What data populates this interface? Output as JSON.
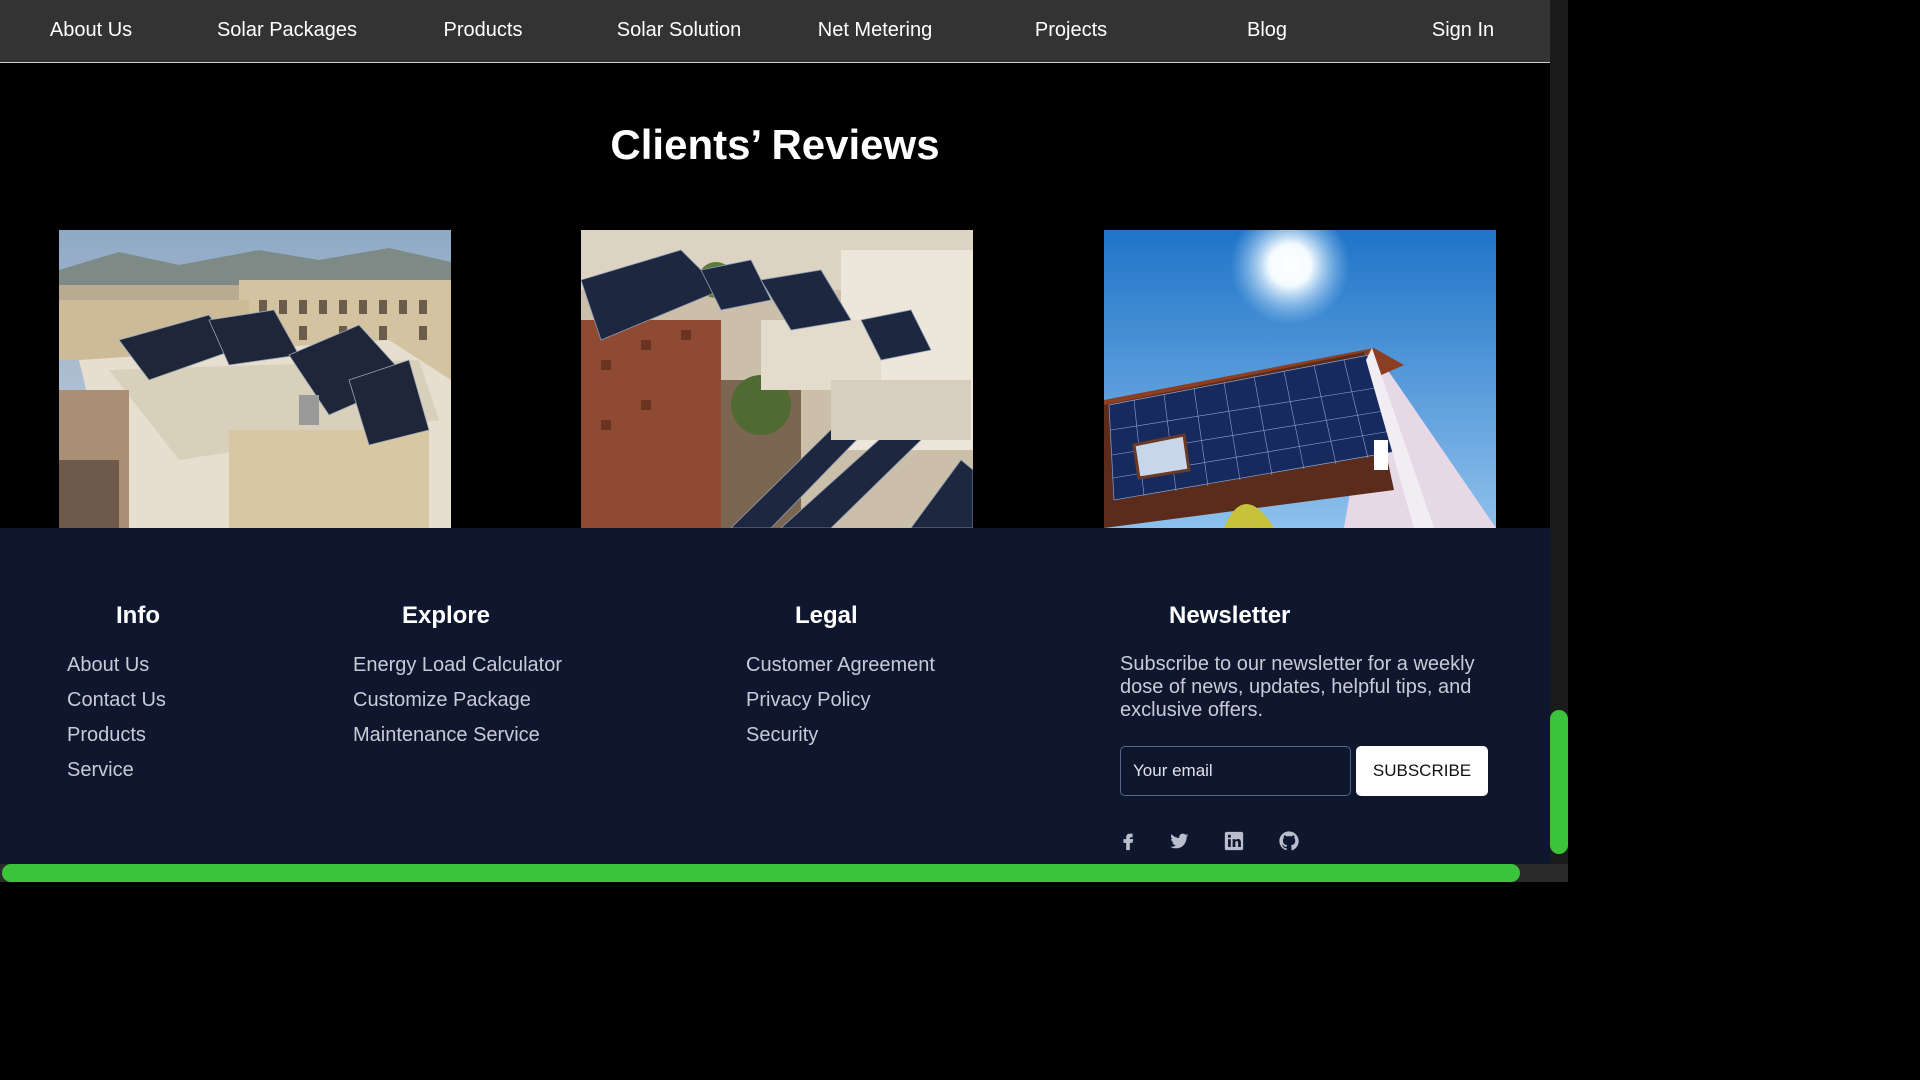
{
  "nav": {
    "items": [
      "About Us",
      "Solar Packages",
      "Products",
      "Solar Solution",
      "Net Metering",
      "Projects",
      "Blog",
      "Sign In"
    ]
  },
  "reviews": {
    "title": "Clients’ Reviews",
    "images": [
      "solar-rooftop-apartment-photo",
      "solar-rooftops-city-photo",
      "solar-roof-house-photo"
    ]
  },
  "footer": {
    "info": {
      "title": "Info",
      "links": [
        "About Us",
        "Contact Us",
        "Products",
        "Service"
      ]
    },
    "explore": {
      "title": "Explore",
      "links": [
        "Energy Load Calculator",
        "Customize Package",
        "Maintenance Service"
      ]
    },
    "legal": {
      "title": "Legal",
      "links": [
        "Customer Agreement",
        "Privacy Policy",
        "Security"
      ]
    },
    "newsletter": {
      "title": "Newsletter",
      "text": "Subscribe to our newsletter for a weekly dose of news, updates, helpful tips, and exclusive offers.",
      "email_placeholder": "Your email",
      "subscribe_label": "SUBSCRIBE"
    },
    "social_icons": [
      "facebook-icon",
      "twitter-icon",
      "linkedin-icon",
      "github-icon"
    ]
  },
  "colors": {
    "nav_bg": "#333333",
    "footer_bg": "#0f172f",
    "scrollbar_thumb": "#3bc43b"
  }
}
